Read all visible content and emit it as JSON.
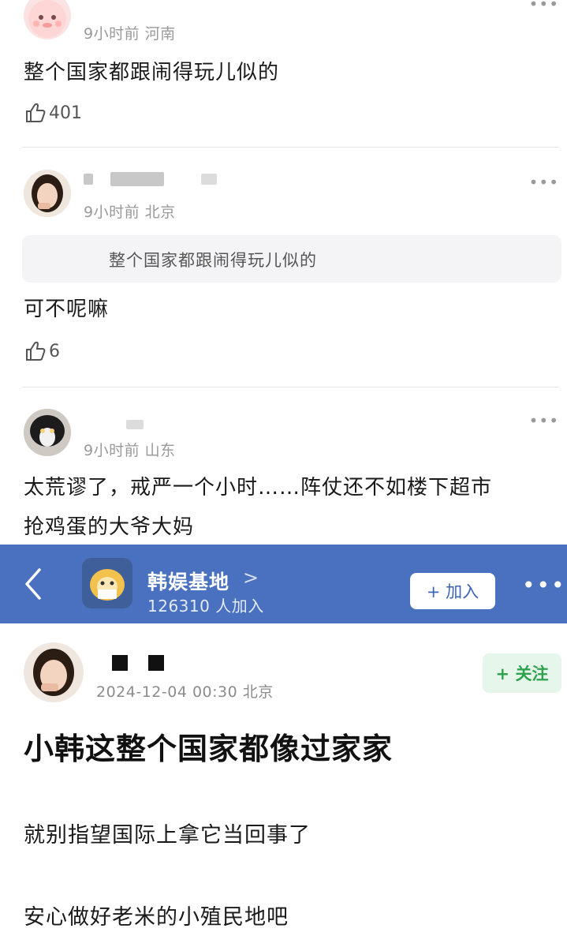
{
  "comments": [
    {
      "meta": "9小时前 河南",
      "text": "整个国家都跟闹得玩儿似的",
      "likes": "401"
    },
    {
      "meta": "9小时前 北京",
      "quote": "整个国家都跟闹得玩儿似的",
      "text": "可不呢嘛",
      "likes": "6"
    },
    {
      "meta": "9小时前 山东",
      "text_line1": "太荒谬了，戒严一个小时……阵仗还不如楼下超市",
      "text_line2": "抢鸡蛋的大爷大妈"
    }
  ],
  "more_glyph": "•••",
  "group": {
    "name": "韩娱基地",
    "chevron": ">",
    "count": "126310 人加入",
    "join_label": "+ 加入"
  },
  "post": {
    "meta": "2024-12-04 00:30  北京",
    "follow_label": "+ 关注",
    "title": "小韩这整个国家都像过家家",
    "line1": "就别指望国际上拿它当回事了",
    "line2": "安心做好老米的小殖民地吧"
  },
  "colors": {
    "topbar": "#4a70c0",
    "follow_green": "#2fa24e"
  },
  "icons": [
    "thumbs-up-icon",
    "more-icon",
    "back-icon",
    "chevron-right-icon"
  ]
}
